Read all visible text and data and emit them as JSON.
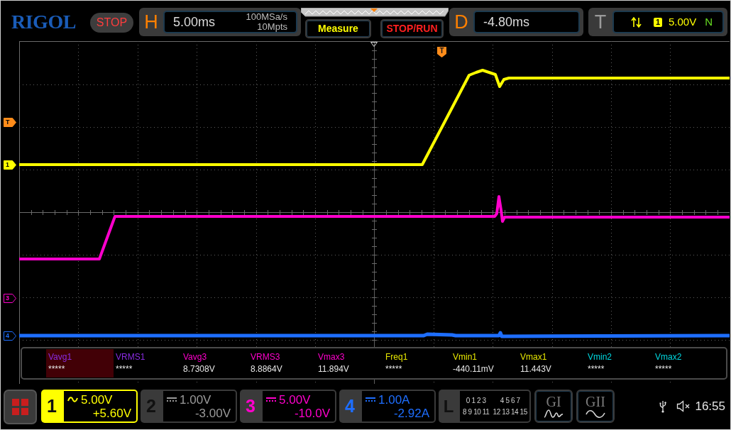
{
  "top_bar": {
    "logo": "RIGOL",
    "run_state": "STOP",
    "horizontal": {
      "label": "H",
      "timebase": "5.00ms",
      "sample_rate": "100MSa/s",
      "memory_depth": "10Mpts"
    },
    "buttons": [
      "Measure",
      "STOP/RUN"
    ],
    "delay": {
      "label": "D",
      "value": "-4.80ms"
    },
    "trigger": {
      "label": "T",
      "source": "1",
      "level": "5.00V",
      "mode": "N"
    }
  },
  "display": {
    "trigger_marker": "T",
    "channel_markers": [
      {
        "label": "T",
        "color": "#ff8c1a",
        "filled": true
      },
      {
        "label": "1",
        "color": "#ffff00",
        "filled": true
      },
      {
        "label": "3",
        "color": "#ff00cc",
        "filled": false
      },
      {
        "label": "4",
        "color": "#1e6eff",
        "filled": false
      }
    ],
    "measurements": [
      {
        "label": "Vavg1",
        "value": "*****",
        "color": "#8a2be2",
        "selected": true
      },
      {
        "label": "VRMS1",
        "value": "*****",
        "color": "#8a2be2",
        "selected": false
      },
      {
        "label": "Vavg3",
        "value": "8.7308V",
        "color": "#ff00cc",
        "selected": false
      },
      {
        "label": "VRMS3",
        "value": "8.8864V",
        "color": "#ff00cc",
        "selected": false
      },
      {
        "label": "Vmax3",
        "value": "11.894V",
        "color": "#ff00cc",
        "selected": false
      },
      {
        "label": "Freq1",
        "value": "*****",
        "color": "#e6e600",
        "selected": false
      },
      {
        "label": "Vmin1",
        "value": "-440.11mV",
        "color": "#e6e600",
        "selected": false
      },
      {
        "label": "Vmax1",
        "value": "11.443V",
        "color": "#e6e600",
        "selected": false
      },
      {
        "label": "Vmin2",
        "value": "*****",
        "color": "#00d8e0",
        "selected": false
      },
      {
        "label": "Vmax2",
        "value": "*****",
        "color": "#00d8e0",
        "selected": false
      }
    ]
  },
  "bottom_bar": {
    "channels": [
      {
        "number": "1",
        "kind": "ac",
        "scale": "5.00V",
        "offset": "+5.60V",
        "on": true,
        "color": "#ffff00",
        "selected": true
      },
      {
        "number": "2",
        "kind": "dc",
        "scale": "1.00V",
        "offset": "-3.00V",
        "on": false,
        "selected": false
      },
      {
        "number": "3",
        "kind": "dc",
        "scale": "5.00V",
        "offset": "-10.0V",
        "on": true,
        "color": "#ff00cc",
        "selected": false
      },
      {
        "number": "4",
        "kind": "dc",
        "scale": "1.00A",
        "offset": "-2.92A",
        "on": true,
        "color": "#1e6eff",
        "selected": false
      }
    ],
    "logic": {
      "label": "L",
      "channel_groups": [
        "0 1 2 3",
        "4 5 6 7",
        "8 9 10 11",
        "12 13 14 15"
      ]
    },
    "generators": [
      {
        "label": "GI",
        "kind": "arbitrary"
      },
      {
        "label": "GII",
        "kind": "sine"
      }
    ],
    "time": "16:55"
  }
}
